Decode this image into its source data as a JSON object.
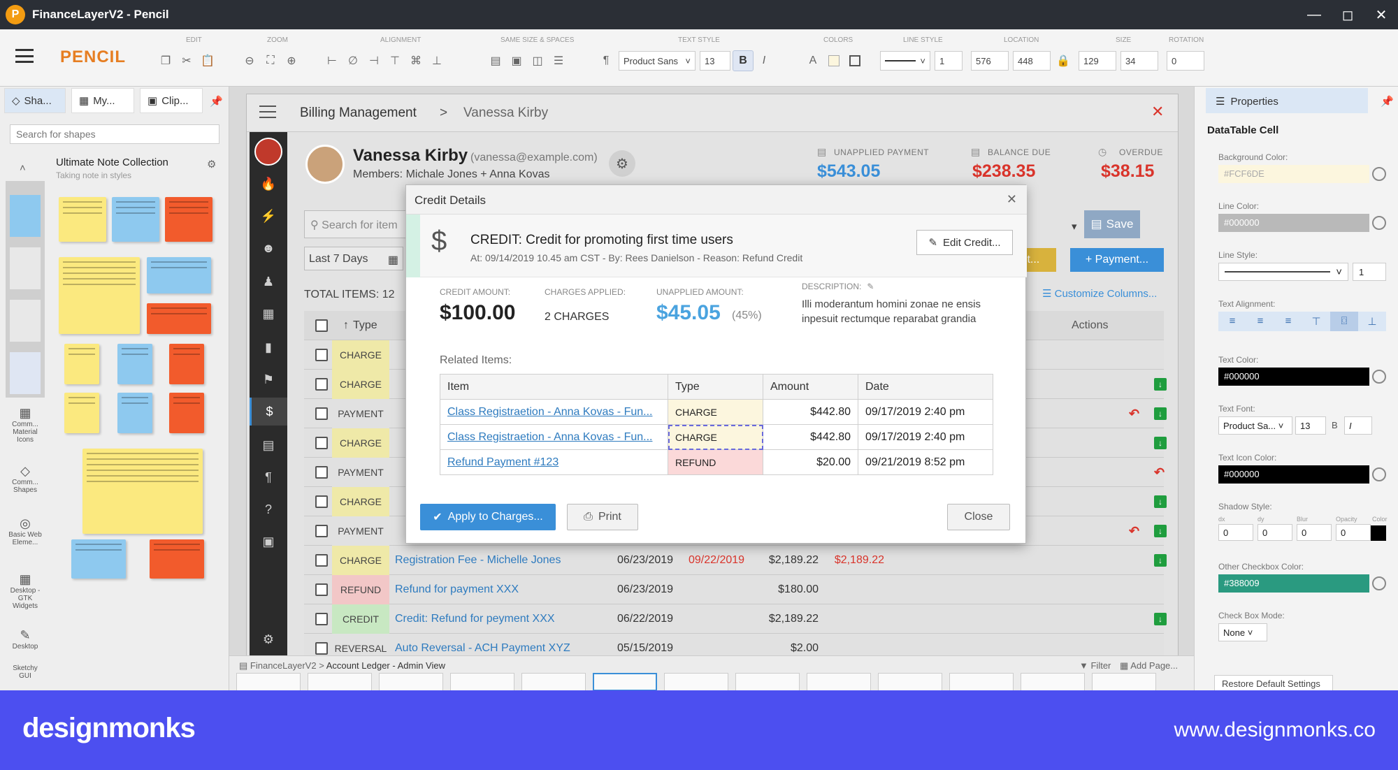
{
  "window": {
    "title": "FinanceLayerV2 - Pencil",
    "logo": "P"
  },
  "toolbar": {
    "brand": "PENCIL",
    "groups": [
      "EDIT",
      "ZOOM",
      "ALIGNMENT",
      "SAME SIZE & SPACES",
      "TEXT STYLE",
      "COLORS",
      "LINE STYLE",
      "LOCATION",
      "SIZE",
      "ROTATION"
    ],
    "font": "Product Sans",
    "font_size": "13",
    "line_width": "1",
    "loc_x": "576",
    "loc_y": "448",
    "size_w": "129",
    "size_h": "34",
    "rotation": "0"
  },
  "left_panel": {
    "tabs": [
      "Sha...",
      "My...",
      "Clip..."
    ],
    "search_placeholder": "Search for shapes",
    "collection_title": "Ultimate Note Collection",
    "collection_sub": "Taking note in styles",
    "categories": [
      "Comm... Material Icons",
      "Comm... Shapes",
      "Basic Web Eleme...",
      "Desktop - GTK Widgets",
      "Desktop",
      "Sketchy GUI"
    ]
  },
  "app": {
    "breadcrumb_root": "Billing Management",
    "breadcrumb_sep": ">",
    "breadcrumb_current": "Vanessa Kirby",
    "customer": {
      "name": "Vanessa Kirby",
      "email": "(vanessa@example.com)",
      "members": "Members: Michale Jones + Anna Kovas"
    },
    "kpis": [
      {
        "label": "UNAPPLIED PAYMENT",
        "value": "$543.05",
        "color": "#3a8fd8"
      },
      {
        "label": "BALANCE DUE",
        "value": "$238.35",
        "color": "#d9342b"
      },
      {
        "label": "OVERDUE",
        "value": "$38.15",
        "color": "#d9342b"
      }
    ],
    "search_placeholder": "Search for item",
    "date_filter": "Last 7 Days",
    "total_items": "TOTAL ITEMS: 12",
    "save": "Save",
    "credit_btn": "dit...",
    "payment_btn": "+ Payment...",
    "customize": "Customize Columns...",
    "col_type": "Type",
    "col_actions": "Actions",
    "rows": [
      {
        "type": "CHARGE",
        "color": "#efe9a8",
        "desc": "",
        "date": "",
        "due": "",
        "amount": "",
        "balance": "",
        "actions": [
          "pen"
        ]
      },
      {
        "type": "CHARGE",
        "color": "#efe9a8",
        "desc": "",
        "date": "",
        "due": "",
        "amount": "",
        "balance": "",
        "actions": [
          "dl",
          "pen"
        ]
      },
      {
        "type": "PAYMENT",
        "color": "#e1e1e1",
        "desc": "",
        "date": "",
        "due": "",
        "amount": "",
        "balance": "",
        "actions": [
          "undo",
          "dl",
          "pen"
        ]
      },
      {
        "type": "CHARGE",
        "color": "#efe9a8",
        "desc": "",
        "date": "",
        "due": "",
        "amount": "",
        "balance": "",
        "actions": [
          "dl",
          "pen"
        ]
      },
      {
        "type": "PAYMENT",
        "color": "#e1e1e1",
        "desc": "",
        "date": "",
        "due": "",
        "amount": "",
        "balance": "",
        "actions": [
          "undo",
          "pen"
        ]
      },
      {
        "type": "CHARGE",
        "color": "#efe9a8",
        "desc": "",
        "date": "",
        "due": "",
        "amount": "",
        "balance": "",
        "actions": [
          "dl",
          "pen"
        ]
      },
      {
        "type": "PAYMENT",
        "color": "#e1e1e1",
        "desc": "",
        "date": "",
        "due": "",
        "amount": "",
        "balance": "",
        "actions": [
          "undo",
          "dl",
          "pen"
        ]
      },
      {
        "type": "CHARGE",
        "color": "#efe9a8",
        "desc": "Registration Fee - Michelle Jones",
        "date": "06/23/2019",
        "due": "09/22/2019",
        "amount": "$2,189.22",
        "balance": "$2,189.22",
        "actions": [
          "dl",
          "pen"
        ]
      },
      {
        "type": "REFUND",
        "color": "#f2c7c7",
        "desc": "Refund for payment XXX",
        "date": "06/23/2019",
        "due": "",
        "amount": "$180.00",
        "balance": "",
        "actions": [
          "pen"
        ]
      },
      {
        "type": "CREDIT",
        "color": "#c8e8c2",
        "desc": "Credit: Refund for peyment XXX",
        "date": "06/22/2019",
        "due": "",
        "amount": "$2,189.22",
        "balance": "",
        "actions": [
          "dl",
          "pen"
        ]
      },
      {
        "type": "REVERSAL",
        "color": "#e1e1e1",
        "desc": "Auto Reversal - ACH Payment XYZ",
        "date": "05/15/2019",
        "due": "",
        "amount": "$2.00",
        "balance": "",
        "actions": []
      }
    ]
  },
  "modal": {
    "title": "Credit Details",
    "heading": "CREDIT: Credit for promoting first time users",
    "meta": "At: 09/14/2019 10.45 am CST  - By: Rees Danielson - Reason: Refund Credit",
    "edit": "Edit Credit...",
    "credit_label": "CREDIT AMOUNT:",
    "credit_value": "$100.00",
    "charges_label": "CHARGES APPLIED:",
    "charges_value": "2 CHARGES",
    "unapplied_label": "UNAPPLIED AMOUNT:",
    "unapplied_value": "$45.05",
    "unapplied_pct": "(45%)",
    "desc_label": "DESCRIPTION:",
    "desc_text": "Illi moderantum homini zonae ne ensis inpesuit rectumque reparabat grandia",
    "related": "Related Items:",
    "cols": [
      "Item",
      "Type",
      "Amount",
      "Date"
    ],
    "items": [
      {
        "item": "Class Registraetion - Anna Kovas - Fun...",
        "type": "CHARGE",
        "amount": "$442.80",
        "date": "09/17/2019 2:40 pm"
      },
      {
        "item": "Class Registraetion - Anna Kovas - Fun...",
        "type": "CHARGE",
        "amount": "$442.80",
        "date": "09/17/2019 2:40 pm"
      },
      {
        "item": "Refund Payment #123",
        "type": "REFUND",
        "amount": "$20.00",
        "date": "09/21/2019 8:52 pm"
      }
    ],
    "apply": "Apply to Charges...",
    "print": "Print",
    "close": "Close"
  },
  "right_panel": {
    "title": "Properties",
    "element": "DataTable Cell",
    "bg_label": "Background Color:",
    "bg_value": "#FCF6DE",
    "line_label": "Line Color:",
    "line_value": "#000000",
    "linestyle_label": "Line Style:",
    "linestyle_width": "1",
    "align_label": "Text Alignment:",
    "textcolor_label": "Text Color:",
    "textcolor_value": "#000000",
    "font_label": "Text Font:",
    "font_value": "Product Sa...",
    "font_size": "13",
    "font_b": "B",
    "font_i": "I",
    "iconcolor_label": "Text Icon Color:",
    "iconcolor_value": "#000000",
    "shadow_label": "Shadow Style:",
    "shadow_cols": [
      "dx",
      "dy",
      "Blur",
      "Opacity",
      "Color"
    ],
    "shadow_vals": [
      "0",
      "0",
      "0",
      "0"
    ],
    "check_color_label": "Other Checkbox Color:",
    "check_color_value": "#388009",
    "checkmode_label": "Check Box Mode:",
    "checkmode_value": "None",
    "restore": "Restore Default Settings"
  },
  "status": {
    "crumb1": "FinanceLayerV2",
    "crumb2": "Account Ledger - Admin View",
    "filter": "Filter",
    "add": "Add Page..."
  },
  "footer": {
    "brand": "designmonks",
    "url": "www.designmonks.co"
  }
}
